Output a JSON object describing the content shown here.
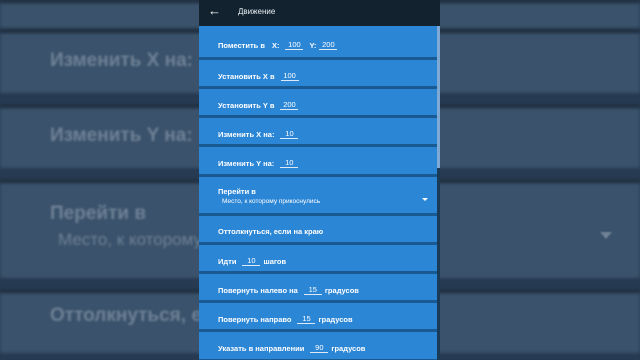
{
  "header": {
    "title": "Движение",
    "back_icon": "arrow-left-icon"
  },
  "background": {
    "row1": "Изменить X на:",
    "row2": "Изменить Y на:",
    "row3_title": "Перейти в",
    "row3_sub": "Место, к которому",
    "row4": "Оттолкнуться, е"
  },
  "blocks": {
    "goto_xy": {
      "label": "Поместить в",
      "x_label": "X:",
      "x_value": "100",
      "y_label": "Y:",
      "y_value": "200"
    },
    "set_x": {
      "label": "Установить X в",
      "value": "100"
    },
    "set_y": {
      "label": "Установить Y в",
      "value": "200"
    },
    "change_x": {
      "label": "Изменить X на:",
      "value": "10"
    },
    "change_y": {
      "label": "Изменить Y на:",
      "value": "10"
    },
    "goto_target": {
      "label": "Перейти в",
      "selected": "Место, к которому прикоснулись"
    },
    "bounce": {
      "label": "Оттолкнуться, если на краю"
    },
    "move": {
      "label": "Идти",
      "value": "10",
      "suffix": "шагов"
    },
    "turn_left": {
      "label": "Повернуть налево на",
      "value": "15",
      "suffix": "градусов"
    },
    "turn_right": {
      "label": "Повернуть направо",
      "value": "15",
      "suffix": "градусов"
    },
    "point_dir": {
      "label": "Указать в направлении",
      "value": "90",
      "suffix": "градусов"
    }
  }
}
